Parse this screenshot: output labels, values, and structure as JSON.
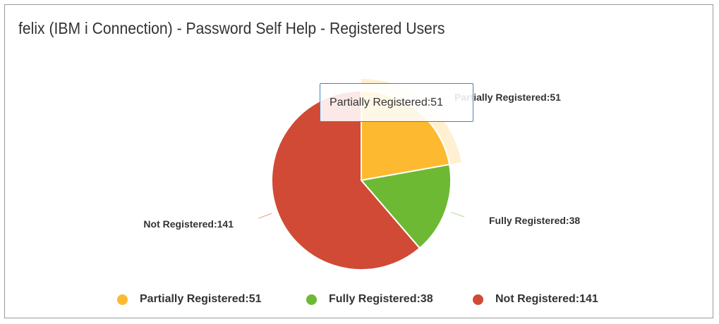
{
  "title": "felix (IBM i Connection) - Password Self Help - Registered Users",
  "tooltip": {
    "text": "Partially Registered:51"
  },
  "legend": [
    {
      "label": "Partially Registered:51",
      "color": "#FDB92F"
    },
    {
      "label": "Fully Registered:38",
      "color": "#6DB933"
    },
    {
      "label": "Not Registered:141",
      "color": "#D04A36"
    }
  ],
  "chart_data": {
    "type": "pie",
    "title": "felix (IBM i Connection) - Password Self Help - Registered Users",
    "categories": [
      "Partially Registered",
      "Fully Registered",
      "Not Registered"
    ],
    "values": [
      51,
      38,
      141
    ],
    "colors": [
      "#FDB92F",
      "#6DB933",
      "#D04A36"
    ],
    "data_labels": [
      "Partially Registered:51",
      "Fully Registered:38",
      "Not Registered:141"
    ],
    "hovered": "Partially Registered",
    "legend_position": "bottom"
  }
}
